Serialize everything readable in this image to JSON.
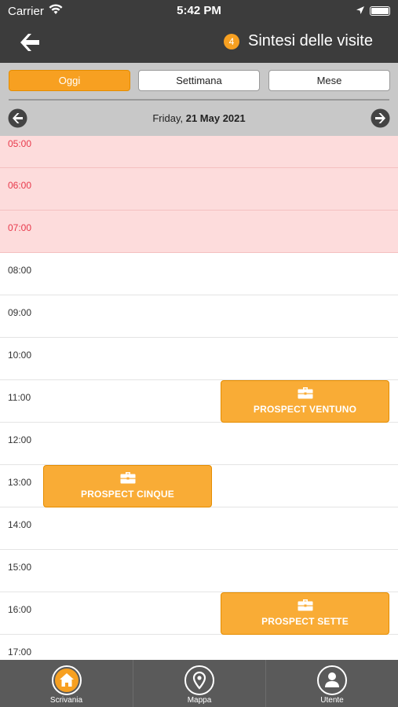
{
  "status_bar": {
    "carrier": "Carrier",
    "time": "5:42 PM"
  },
  "nav": {
    "badge": "4",
    "title": "Sintesi delle visite"
  },
  "segments": [
    {
      "label": "Oggi",
      "active": true
    },
    {
      "label": "Settimana",
      "active": false
    },
    {
      "label": "Mese",
      "active": false
    }
  ],
  "date_header": {
    "weekday": "Friday,",
    "date": "21 May 2021"
  },
  "hours": [
    "05:00",
    "06:00",
    "07:00",
    "08:00",
    "09:00",
    "10:00",
    "11:00",
    "12:00",
    "13:00",
    "14:00",
    "15:00",
    "16:00",
    "17:00"
  ],
  "closed_hours": [
    "05:00",
    "06:00",
    "07:00"
  ],
  "events": [
    {
      "label": "PROSPECT VENTUNO",
      "start": "10:00",
      "end": "11:00",
      "column": "right"
    },
    {
      "label": "PROSPECT CINQUE",
      "start": "12:00",
      "end": "13:00",
      "column": "left"
    },
    {
      "label": "PROSPECT SETTE",
      "start": "15:00",
      "end": "16:00",
      "column": "right"
    }
  ],
  "tabs": [
    {
      "label": "Scrivania",
      "icon": "home-icon"
    },
    {
      "label": "Mappa",
      "icon": "map-pin-icon"
    },
    {
      "label": "Utente",
      "icon": "user-icon"
    }
  ],
  "colors": {
    "accent": "#f7a021",
    "bar": "#3c3c3c",
    "closed": "#fddcdc",
    "closed_text": "#e8394b"
  }
}
